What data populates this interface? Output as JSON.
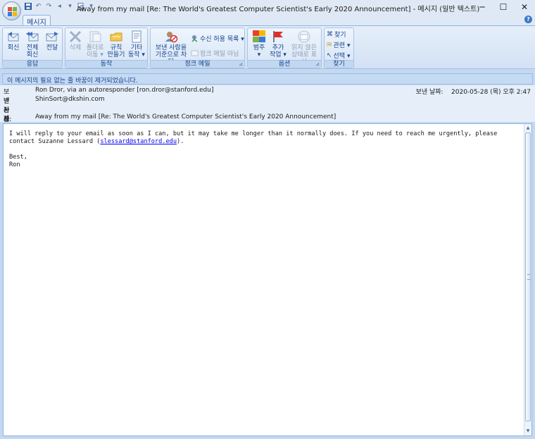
{
  "window": {
    "title": "Away from my mail [Re: The World's Greatest Computer Scientist's Early 2020 Announcement] - 메시지 (일반 텍스트)",
    "minimize": "─",
    "maximize": "☐",
    "close": "✕"
  },
  "qat": [
    "save-icon",
    "undo-icon",
    "redo-icon",
    "previous-icon",
    "next-icon",
    "print-preview-icon",
    "customize-icon"
  ],
  "ribbon": {
    "tab": "메시지",
    "groups": {
      "respond": {
        "label": "응답",
        "reply": "회신",
        "reply_all_1": "전체",
        "reply_all_2": "회신",
        "forward": "전달"
      },
      "actions": {
        "label": "동작",
        "delete": "삭제",
        "move_1": "폴더로",
        "move_2": "이동 ▾",
        "rules_1": "규칙",
        "rules_2": "만들기",
        "other_1": "기타",
        "other_2": "동작 ▾"
      },
      "junk": {
        "label": "정크 메일",
        "block_1": "보낸 사람을",
        "block_2": "기준으로 차단",
        "safe_list": "수신 허용 목록 ▾",
        "not_junk": "정크 메일 아님"
      },
      "options": {
        "label": "옵션",
        "categorize_1": "범주",
        "categorize_2": "▾",
        "followup_1": "추가",
        "followup_2": "작업 ▾",
        "unread_1": "읽지 않은",
        "unread_2": "상태로 표시"
      },
      "find": {
        "label": "찾기",
        "find": "찾기",
        "related": "관련 ▾",
        "select": "선택 ▾"
      }
    }
  },
  "infobar": "이 메시지의 필요 없는 줄 바꿈이 제거되었습니다.",
  "header": {
    "from_label": "보낸 사람:",
    "from_value": "Ron Dror, via an autoresponder [ron.dror@stanford.edu]",
    "to_label": "받는 사람:",
    "to_value": "ShinSort@dkshin.com",
    "cc_label": "참조:",
    "cc_value": "",
    "subject_label": "제목:",
    "subject_value": "Away from my mail [Re: The World's Greatest Computer Scientist's Early 2020 Announcement]",
    "sent_label": "보낸 날짜:",
    "sent_value": "2020-05-28 (목) 오후 2:47"
  },
  "body": {
    "line1": "I will reply to your email as soon as I can, but it may take me longer than it normally does. If you need to reach me urgently, please",
    "line2_prefix": "contact Suzanne Lessard (",
    "link": "slessard@stanford.edu",
    "line2_suffix": ").",
    "closing": "Best,",
    "signature": "Ron"
  },
  "colors": {
    "ribbon": "#dfe9f5",
    "accent": "#15428b",
    "link": "#0000ee"
  }
}
